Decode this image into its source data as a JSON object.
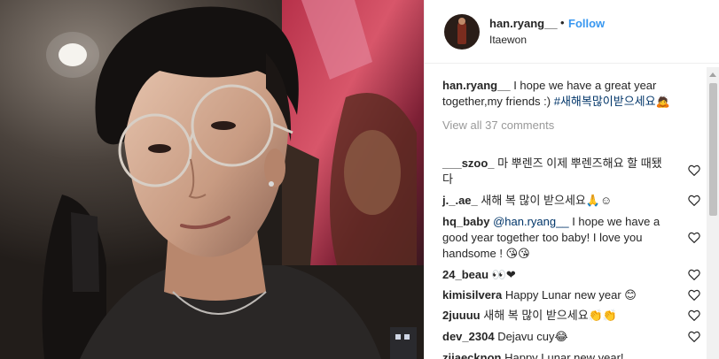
{
  "post": {
    "username": "han.ryang__",
    "separator": "•",
    "follow_label": "Follow",
    "location": "Itaewon",
    "caption_text": " I hope we have a great year together,my friends :) ",
    "caption_tag": "#새해복많이받으세요",
    "caption_emoji": "🙇",
    "view_all_label": "View all 37 comments"
  },
  "comments": [
    {
      "user": "___szoo_",
      "text": "마 뿌렌즈 이제 뿌렌즈해요 할 때됐다"
    },
    {
      "user": "j._.ae_",
      "text": "새해 복 많이 받으세요🙏☺"
    },
    {
      "user": "hq_baby",
      "mention": "@han.ryang__",
      "text": " I hope we have a good year together too baby! I love you handsome ! 😘😘"
    },
    {
      "user": "24_beau",
      "text": "👀❤"
    },
    {
      "user": "kimisilvera",
      "text": "Happy Lunar new year 😊"
    },
    {
      "user": "2juuuu",
      "text": "새해 복 많이 받으세요👏👏"
    },
    {
      "user": "dev_2304",
      "text": "Dejavu cuy😂"
    },
    {
      "user": "ziiaecknon",
      "text": "Happy Lunar new year!"
    }
  ],
  "colors": {
    "link_blue": "#3897f0",
    "hashtag": "#003569",
    "muted": "#999999"
  }
}
